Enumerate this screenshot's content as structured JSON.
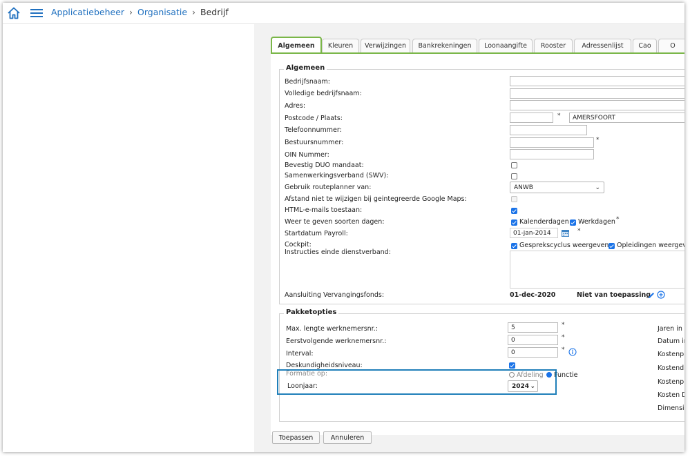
{
  "breadcrumb": {
    "item1": "Applicatiebeheer",
    "item2": "Organisatie",
    "current": "Bedrijf",
    "separator": "›"
  },
  "tabs": [
    "Algemeen",
    "Kleuren",
    "Verwijzingen",
    "Bankrekeningen",
    "Loonaangifte",
    "Rooster",
    "Adressenlijst",
    "Cao",
    "O"
  ],
  "algemeen": {
    "legend": "Algemeen",
    "bedrijfsnaam": "Bedrijfsnaam:",
    "volledige": "Volledige bedrijfsnaam:",
    "adres": "Adres:",
    "postcode": "Postcode / Plaats:",
    "plaats_value": "AMERSFOORT",
    "telefoon": "Telefoonnummer:",
    "bestuur": "Bestuursnummer:",
    "oin": "OIN Nummer:",
    "duo": "Bevestig DUO mandaat:",
    "swv": "Samenwerkingsverband (SWV):",
    "routeplanner": "Gebruik routeplanner van:",
    "routeplanner_value": "ANWB",
    "afstand": "Afstand niet te wijzigen bij geintegreerde Google Maps:",
    "html_mails": "HTML-e-mails toestaan:",
    "soorten_dagen": "Weer te geven soorten dagen:",
    "kalenderdagen": "Kalenderdagen",
    "werkdagen": "Werkdagen",
    "startdatum": "Startdatum Payroll:",
    "startdatum_value": "01-jan-2014",
    "cockpit": "Cockpit:",
    "gesprek": "Gesprekscyclus weergeven",
    "opleidingen": "Opleidingen weergeve",
    "instructies": "Instructies einde dienstverband:",
    "aansluiting": "Aansluiting Vervangingsfonds:",
    "aansluiting_date": "01-dec-2020",
    "aansluiting_status": "Niet van toepassing",
    "required_mark": "*"
  },
  "pakket": {
    "legend": "Pakketopties",
    "max_lengte": "Max. lengte werknemersnr.:",
    "max_lengte_value": "5",
    "eerstvolgende": "Eerstvolgende werknemersnr.:",
    "eerstvolgende_value": "0",
    "interval": "Interval:",
    "interval_value": "0",
    "deskundigheid": "Deskundigheidsniveau:",
    "formatie": "Formatie op:",
    "afdeling": "Afdeling",
    "functie": "Functie",
    "loonjaar": "Loonjaar:",
    "loonjaar_value": "2024",
    "right_labels": [
      "Jaren in",
      "Datum in",
      "Kostenpl",
      "Kostendr",
      "Kostenpl",
      "Kosten D",
      "Dimensie"
    ]
  },
  "buttons": {
    "apply": "Toepassen",
    "cancel": "Annuleren"
  },
  "colors": {
    "accent_green": "#7ab648",
    "link_blue": "#1e6fbf",
    "highlight": "#1f7fb9",
    "check_blue": "#1a73e8"
  }
}
